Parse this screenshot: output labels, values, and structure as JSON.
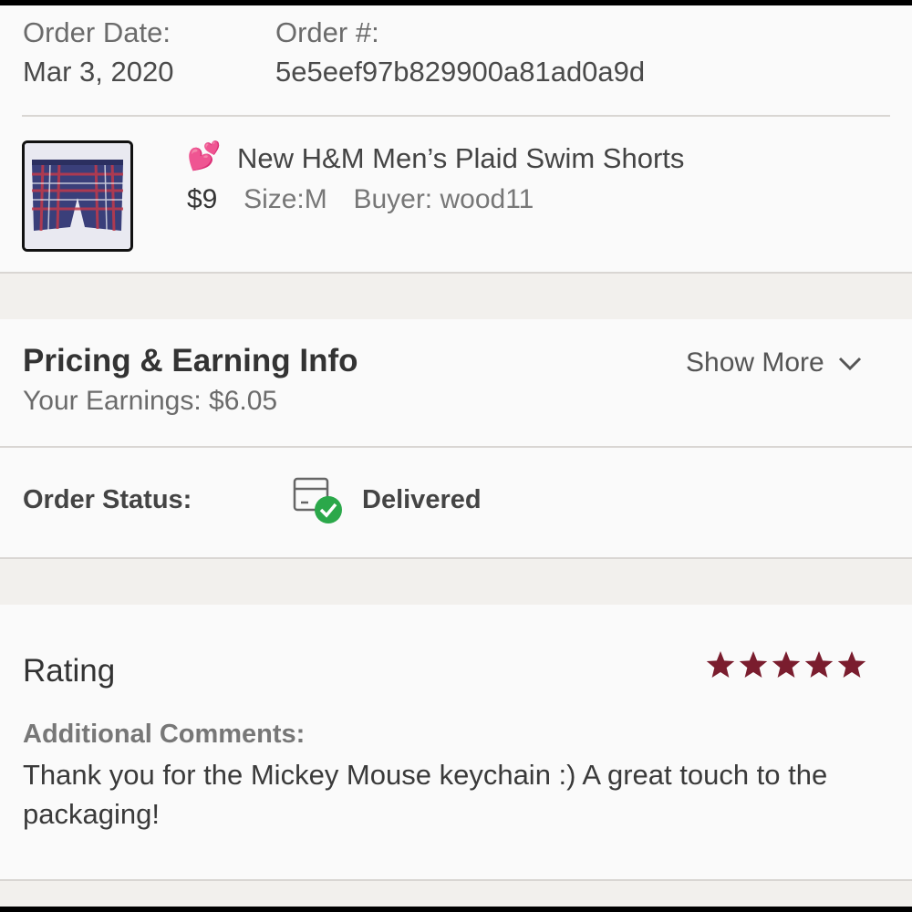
{
  "order": {
    "date_label": "Order Date:",
    "date_value": "Mar 3, 2020",
    "number_label": "Order #:",
    "number_value": "5e5eef97b829900a81ad0a9d"
  },
  "item": {
    "emoji": "💕",
    "title": "New H&M Men’s Plaid Swim Shorts",
    "price": "$9",
    "size": "Size:M",
    "buyer": "Buyer: wood11"
  },
  "pricing": {
    "title": "Pricing & Earning Info",
    "earnings": "Your Earnings: $6.05",
    "show_more": "Show More"
  },
  "status": {
    "label": "Order Status:",
    "value": "Delivered"
  },
  "rating": {
    "title": "Rating",
    "stars": 5,
    "comment_label": "Additional Comments:",
    "comment": "Thank you for the Mickey Mouse keychain :) A great touch to the packaging!"
  },
  "colors": {
    "star": "#7a1d2e",
    "delivered_check": "#2ba84a"
  }
}
